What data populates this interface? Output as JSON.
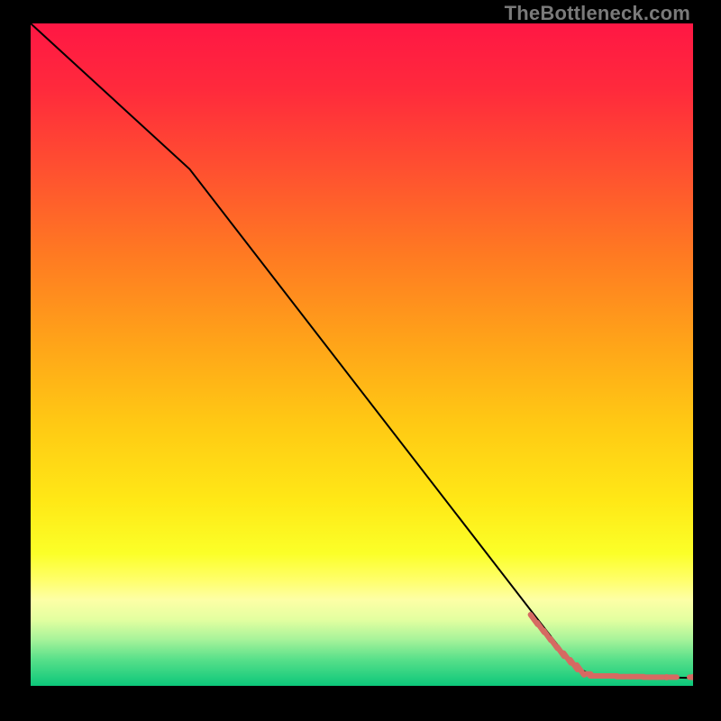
{
  "watermark": "TheBottleneck.com",
  "chart_data": {
    "type": "line",
    "title": "",
    "xlabel": "",
    "ylabel": "",
    "xlim": [
      0,
      100
    ],
    "ylim": [
      0,
      100
    ],
    "grid": false,
    "legend": false,
    "series": [
      {
        "name": "curve",
        "style": "line",
        "color": "#000000",
        "points": [
          {
            "x": 0,
            "y": 100
          },
          {
            "x": 24,
            "y": 78
          },
          {
            "x": 82,
            "y": 3
          },
          {
            "x": 85,
            "y": 1.5
          },
          {
            "x": 100,
            "y": 1.2
          }
        ]
      },
      {
        "name": "scatter-cluster",
        "style": "scatter",
        "color": "#d66a62",
        "points": [
          {
            "x": 76,
            "y": 10.0
          },
          {
            "x": 77,
            "y": 8.8
          },
          {
            "x": 78,
            "y": 7.6
          },
          {
            "x": 79,
            "y": 6.4
          },
          {
            "x": 80,
            "y": 5.2
          },
          {
            "x": 81,
            "y": 4.2
          },
          {
            "x": 82,
            "y": 3.2
          },
          {
            "x": 83,
            "y": 2.4
          },
          {
            "x": 84,
            "y": 1.8
          },
          {
            "x": 85,
            "y": 1.5
          },
          {
            "x": 86,
            "y": 1.5
          },
          {
            "x": 87,
            "y": 1.5
          },
          {
            "x": 88,
            "y": 1.5
          },
          {
            "x": 89,
            "y": 1.4
          },
          {
            "x": 90,
            "y": 1.4
          },
          {
            "x": 91,
            "y": 1.4
          },
          {
            "x": 92,
            "y": 1.4
          },
          {
            "x": 93,
            "y": 1.3
          },
          {
            "x": 94,
            "y": 1.3
          },
          {
            "x": 95,
            "y": 1.3
          },
          {
            "x": 97,
            "y": 1.3
          },
          {
            "x": 100,
            "y": 1.3
          }
        ]
      }
    ],
    "background": {
      "type": "vertical-gradient",
      "stops": [
        {
          "pos": 0.0,
          "color": "#ff1744"
        },
        {
          "pos": 0.5,
          "color": "#ffb81a"
        },
        {
          "pos": 0.8,
          "color": "#fbff28"
        },
        {
          "pos": 1.0,
          "color": "#0cc77a"
        }
      ]
    }
  }
}
